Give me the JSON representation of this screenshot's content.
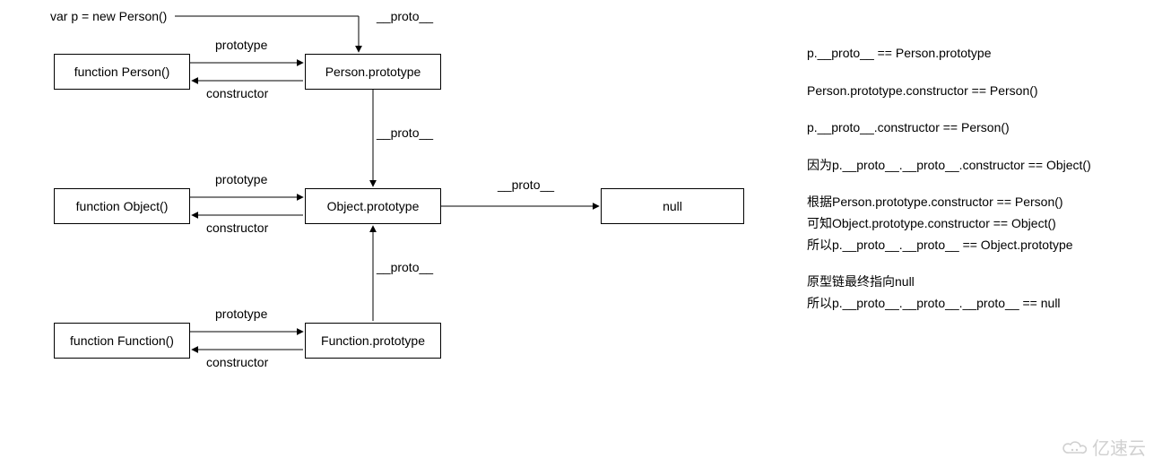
{
  "topVar": "var p = new Person()",
  "boxes": {
    "functionPerson": "function Person()",
    "personPrototype": "Person.prototype",
    "functionObject": "function Object()",
    "objectPrototype": "Object.prototype",
    "functionFunction": "function Function()",
    "functionPrototype": "Function.prototype",
    "nullBox": "null"
  },
  "labels": {
    "proto": "__proto__",
    "prototype": "prototype",
    "constructor": "constructor"
  },
  "notes": {
    "n1": "p.__proto__ == Person.prototype",
    "n2": "Person.prototype.constructor ==  Person()",
    "n3": "p.__proto__.constructor ==  Person()",
    "n4": "因为p.__proto__.__proto__.constructor == Object()",
    "n5a": "根据Person.prototype.constructor == Person()",
    "n5b": "可知Object.prototype.constructor == Object()",
    "n5c": "所以p.__proto__.__proto__ == Object.prototype",
    "n6a": "原型链最终指向null",
    "n6b": "所以p.__proto__.__proto__.__proto__ == null"
  },
  "watermark": "亿速云",
  "chart_data": {
    "type": "diagram",
    "title": "JavaScript prototype chain",
    "nodes": [
      {
        "id": "p",
        "label": "var p = new Person()"
      },
      {
        "id": "functionPerson",
        "label": "function Person()"
      },
      {
        "id": "personPrototype",
        "label": "Person.prototype"
      },
      {
        "id": "functionObject",
        "label": "function Object()"
      },
      {
        "id": "objectPrototype",
        "label": "Object.prototype"
      },
      {
        "id": "functionFunction",
        "label": "function Function()"
      },
      {
        "id": "functionPrototype",
        "label": "Function.prototype"
      },
      {
        "id": "null",
        "label": "null"
      }
    ],
    "edges": [
      {
        "from": "p",
        "to": "personPrototype",
        "label": "__proto__"
      },
      {
        "from": "functionPerson",
        "to": "personPrototype",
        "label": "prototype"
      },
      {
        "from": "personPrototype",
        "to": "functionPerson",
        "label": "constructor"
      },
      {
        "from": "personPrototype",
        "to": "objectPrototype",
        "label": "__proto__"
      },
      {
        "from": "functionObject",
        "to": "objectPrototype",
        "label": "prototype"
      },
      {
        "from": "objectPrototype",
        "to": "functionObject",
        "label": "constructor"
      },
      {
        "from": "functionFunction",
        "to": "functionPrototype",
        "label": "prototype"
      },
      {
        "from": "functionPrototype",
        "to": "functionFunction",
        "label": "constructor"
      },
      {
        "from": "functionPrototype",
        "to": "objectPrototype",
        "label": "__proto__"
      },
      {
        "from": "objectPrototype",
        "to": "null",
        "label": "__proto__"
      }
    ],
    "equalities": [
      "p.__proto__ == Person.prototype",
      "Person.prototype.constructor == Person()",
      "p.__proto__.constructor == Person()",
      "p.__proto__.__proto__.constructor == Object()",
      "Object.prototype.constructor == Object()",
      "p.__proto__.__proto__ == Object.prototype",
      "p.__proto__.__proto__.__proto__ == null"
    ]
  }
}
